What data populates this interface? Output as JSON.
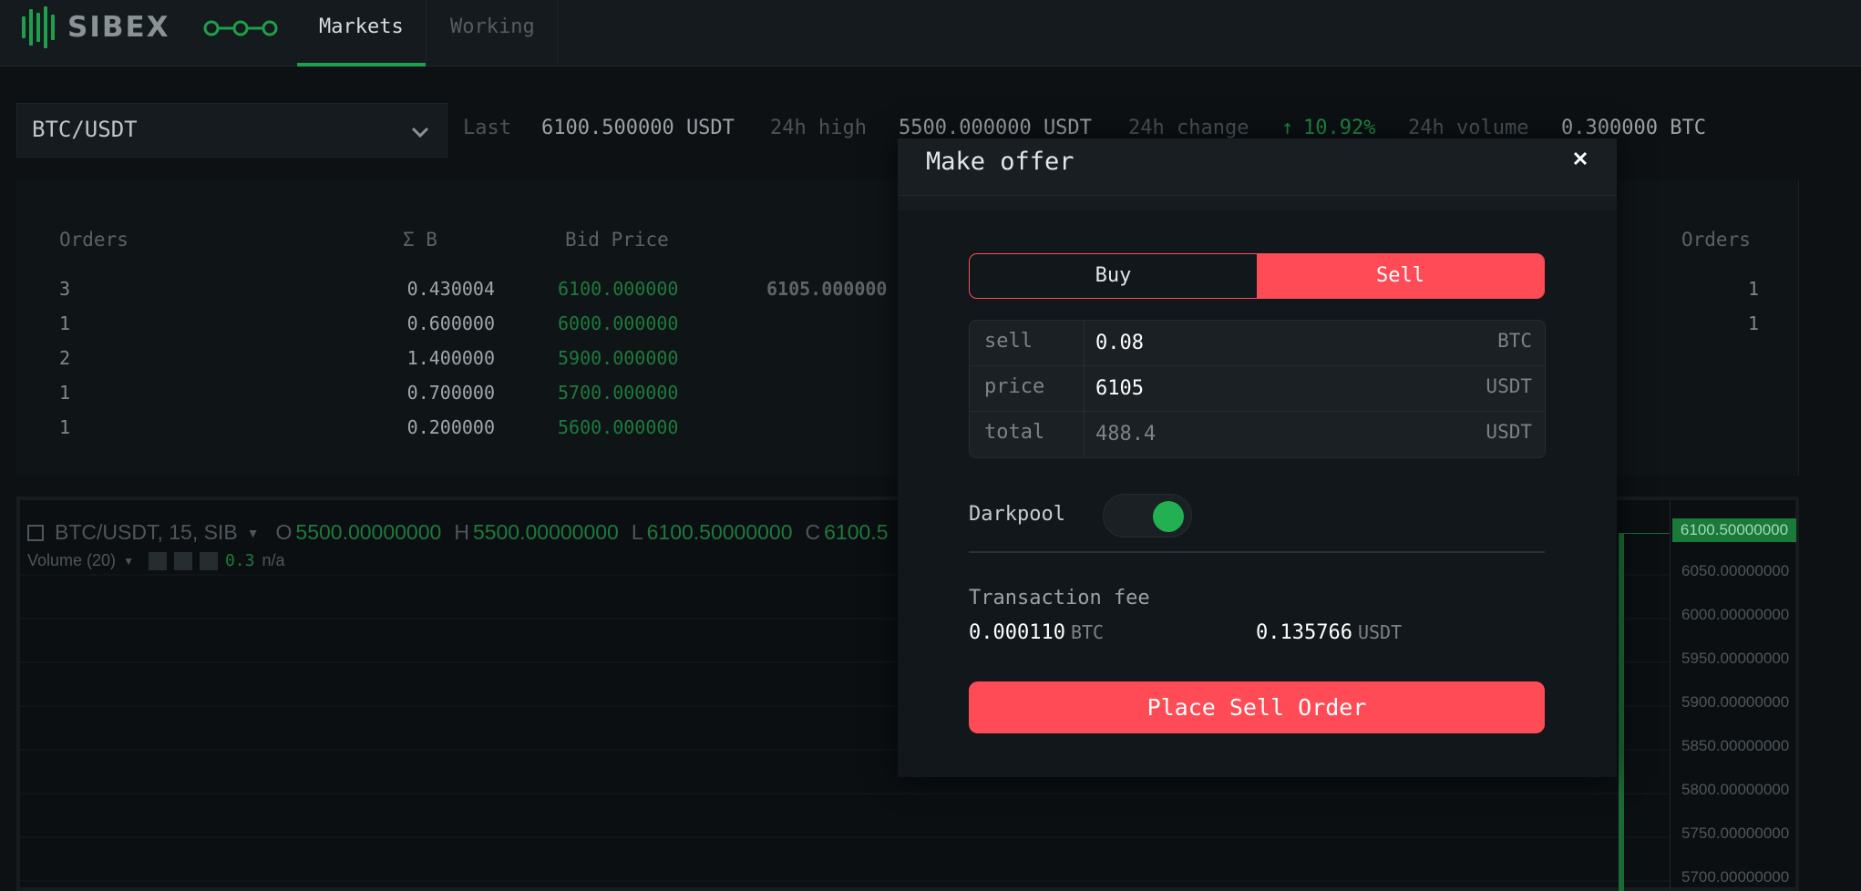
{
  "app": {
    "name": "SIBEX",
    "nav": [
      {
        "label": "Markets",
        "active": true
      },
      {
        "label": "Working",
        "active": false
      }
    ],
    "accent_green": "#1f9e4b",
    "accent_red": "#ff4b55"
  },
  "market": {
    "pair": "BTC/USDT",
    "stats": {
      "last_label": "Last",
      "last_value": "6100.500000 USDT",
      "high_label": "24h high",
      "high_value": "5500.000000 USDT",
      "change_label": "24h change",
      "change_value": "10.92%",
      "change_icon": "arrow-up-icon",
      "volume_label": "24h volume",
      "volume_value": "0.300000 BTC"
    }
  },
  "orderbook": {
    "headers": {
      "orders": "Orders",
      "sum": "Σ B",
      "bid_price": "Bid Price",
      "orders_right": "Orders"
    },
    "rows": [
      {
        "orders": "3",
        "sum": "0.430004",
        "bid": "6100.000000",
        "ask": "6105.000000",
        "orders_right": "1"
      },
      {
        "orders": "1",
        "sum": "0.600000",
        "bid": "6000.000000",
        "ask": "",
        "orders_right": "1"
      },
      {
        "orders": "2",
        "sum": "1.400000",
        "bid": "5900.000000",
        "ask": "",
        "orders_right": ""
      },
      {
        "orders": "1",
        "sum": "0.700000",
        "bid": "5700.000000",
        "ask": "",
        "orders_right": ""
      },
      {
        "orders": "1",
        "sum": "0.200000",
        "bid": "5600.000000",
        "ask": "",
        "orders_right": ""
      }
    ]
  },
  "chart": {
    "title": "BTC/USDT, 15, SIB",
    "o_label": "O",
    "o_value": "5500.00000000",
    "h_label": "H",
    "h_value": "5500.00000000",
    "l_label": "L",
    "l_value": "6100.50000000",
    "c_label": "C",
    "c_value": "6100.5",
    "volume_label": "Volume (20)",
    "volume_value": "0.3",
    "volume_na": "n/a",
    "last_price_tag": "6100.50000000",
    "price_ticks": [
      "6050.00000000",
      "6000.00000000",
      "5950.00000000",
      "5900.00000000",
      "5850.00000000",
      "5800.00000000",
      "5750.00000000",
      "5700.00000000"
    ]
  },
  "modal": {
    "title": "Make offer",
    "close_icon": "close-icon",
    "side_buy": "Buy",
    "side_sell": "Sell",
    "selected_side": "Sell",
    "fields": {
      "amount_label": "sell",
      "amount_value": "0.08",
      "amount_unit": "BTC",
      "price_label": "price",
      "price_value": "6105",
      "price_unit": "USDT",
      "total_label": "total",
      "total_value": "488.4",
      "total_unit": "USDT"
    },
    "darkpool_label": "Darkpool",
    "darkpool_on": true,
    "fee_title": "Transaction fee",
    "fee_btc_value": "0.000110",
    "fee_btc_unit": "BTC",
    "fee_usdt_value": "0.135766",
    "fee_usdt_unit": "USDT",
    "submit_label": "Place Sell Order"
  }
}
